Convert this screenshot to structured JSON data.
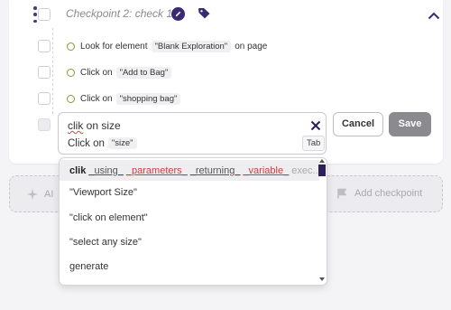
{
  "checkpoint": {
    "title": "Checkpoint 2:  check 1",
    "accent_color": "#3b2a73"
  },
  "steps": [
    {
      "before": "Look for element",
      "chip": "\"Blank Exploration\"",
      "after": "on page"
    },
    {
      "before": "Click on",
      "chip": "\"Add to Bag\"",
      "after": ""
    },
    {
      "before": "Click on",
      "chip": "\"shopping bag\"",
      "after": ""
    }
  ],
  "editor": {
    "typed_misspelled": "clik",
    "typed_rest": " on size",
    "suggestion_prefix": "Click on",
    "suggestion_chip": "\"size\"",
    "tab_hint": "Tab"
  },
  "buttons": {
    "cancel": "Cancel",
    "save": "Save"
  },
  "bottom_bar": {
    "ai_label": "AI",
    "add_checkpoint": "Add checkpoint"
  },
  "dropdown": {
    "first_item": {
      "keyword": "clik",
      "parts": [
        {
          "text": "_using_",
          "style": "plain"
        },
        {
          "text": "_parameters_",
          "style": "red"
        },
        {
          "text": "_returning_",
          "style": "plain"
        },
        {
          "text": "_variable_",
          "style": "red"
        },
        {
          "text": "exec...",
          "style": "gray"
        }
      ]
    },
    "items": [
      "\"Viewport Size\"",
      "\"click on element\"",
      "\"select any size\"",
      "generate"
    ]
  }
}
